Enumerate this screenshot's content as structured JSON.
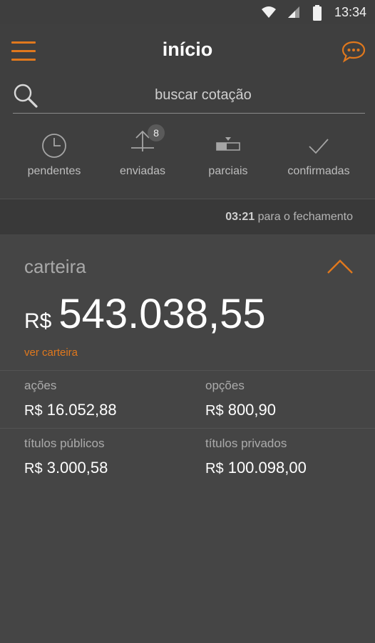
{
  "status_bar": {
    "time": "13:34",
    "icons": [
      "wifi-icon",
      "signal-icon",
      "battery-icon"
    ]
  },
  "header": {
    "title": "início",
    "menu_icon": "hamburger-menu-icon",
    "chat_icon": "chat-bubble-icon"
  },
  "search": {
    "placeholder": "buscar cotação",
    "icon": "search-icon"
  },
  "filters": [
    {
      "label": "pendentes",
      "icon": "clock-icon"
    },
    {
      "label": "enviadas",
      "icon": "upload-icon",
      "badge": "8"
    },
    {
      "label": "parciais",
      "icon": "partial-icon"
    },
    {
      "label": "confirmadas",
      "icon": "check-icon"
    }
  ],
  "closing": {
    "time": "03:21",
    "text": "para o fechamento"
  },
  "wallet": {
    "title": "carteira",
    "currency": "R$",
    "total": "543.038,55",
    "view_link": "ver carteira",
    "assets": [
      {
        "label": "ações",
        "currency": "R$",
        "value": "16.052,88"
      },
      {
        "label": "opções",
        "currency": "R$",
        "value": "800,90"
      },
      {
        "label": "títulos públicos",
        "currency": "R$",
        "value": "3.000,58"
      },
      {
        "label": "títulos privados",
        "currency": "R$",
        "value": "100.098,00"
      }
    ]
  },
  "colors": {
    "accent": "#e0781d",
    "background": "#454545",
    "header_background": "#3f3f3f"
  }
}
